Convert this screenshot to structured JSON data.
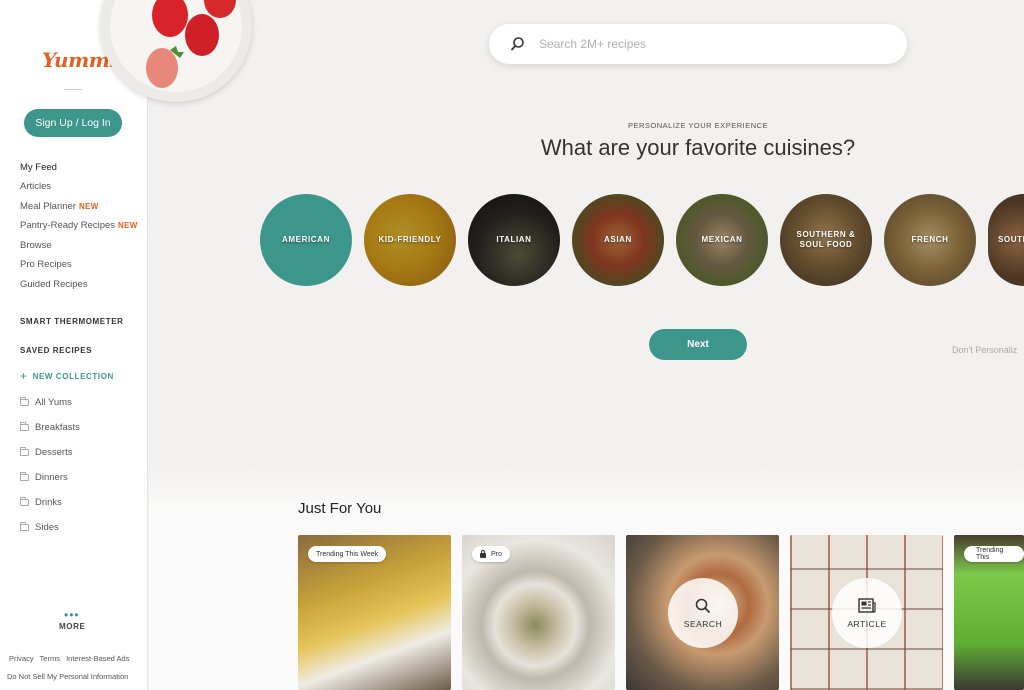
{
  "brand": {
    "logo_text": "Yummly",
    "accent_color": "#3d968c",
    "brand_color": "#e16120"
  },
  "sidebar": {
    "signup_label": "Sign Up / Log In",
    "nav_items": [
      {
        "label": "My Feed",
        "badge": ""
      },
      {
        "label": "Articles",
        "badge": ""
      },
      {
        "label": "Meal Planner",
        "badge": "NEW"
      },
      {
        "label": "Pantry-Ready Recipes",
        "badge": "NEW"
      },
      {
        "label": "Browse",
        "badge": ""
      },
      {
        "label": "Pro Recipes",
        "badge": ""
      },
      {
        "label": "Guided Recipes",
        "badge": ""
      }
    ],
    "smart_thermometer": "SMART THERMOMETER",
    "saved_recipes": "SAVED RECIPES",
    "new_collection": "NEW COLLECTION",
    "collections": [
      "All Yums",
      "Breakfasts",
      "Desserts",
      "Dinners",
      "Drinks",
      "Sides"
    ],
    "more_label": "MORE",
    "footer": {
      "privacy": "Privacy",
      "terms": "Terms",
      "ads": "Interest-Based Ads",
      "do_not_sell": "Do Not Sell My Personal Information"
    }
  },
  "search": {
    "placeholder": "Search 2M+ recipes",
    "value": ""
  },
  "personalize": {
    "eyebrow": "PERSONALIZE YOUR EXPERIENCE",
    "headline": "What are your favorite cuisines?",
    "cuisines": [
      {
        "label": "AMERICAN",
        "selected": true
      },
      {
        "label": "KID-FRIENDLY",
        "selected": false
      },
      {
        "label": "ITALIAN",
        "selected": false
      },
      {
        "label": "ASIAN",
        "selected": false
      },
      {
        "label": "MEXICAN",
        "selected": false
      },
      {
        "label": "SOUTHERN & SOUL FOOD",
        "selected": false
      },
      {
        "label": "FRENCH",
        "selected": false
      },
      {
        "label": "SOUTH",
        "selected": false
      }
    ],
    "next_label": "Next",
    "dont_personalize": "Don't Personaliz"
  },
  "just_for_you": {
    "title": "Just For You",
    "cards": [
      {
        "tag": "Trending This Week",
        "overlay": ""
      },
      {
        "tag": "Pro",
        "overlay": ""
      },
      {
        "tag": "",
        "overlay": "SEARCH"
      },
      {
        "tag": "",
        "overlay": "ARTICLE"
      },
      {
        "tag": "Trending This",
        "overlay": ""
      }
    ]
  }
}
